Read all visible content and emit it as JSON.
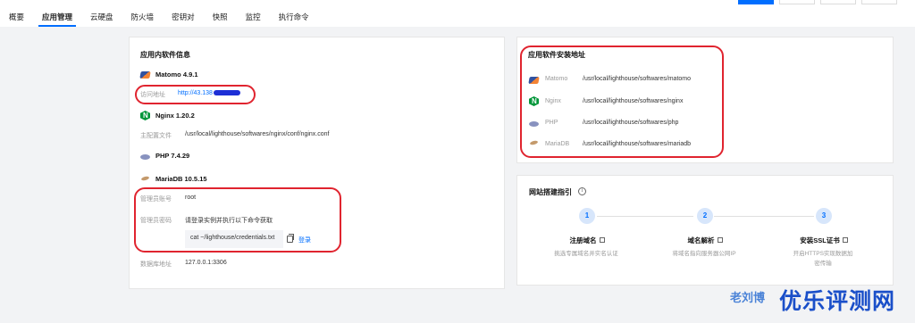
{
  "nav": {
    "tabs": [
      "概要",
      "应用管理",
      "云硬盘",
      "防火墙",
      "密钥对",
      "快照",
      "监控",
      "执行命令"
    ],
    "active_tab": "应用管理"
  },
  "left_card": {
    "title": "应用内软件信息",
    "matomo": {
      "name": "Matomo 4.9.1",
      "access_label": "访问地址",
      "access_value": "http://43.138"
    },
    "nginx": {
      "name": "Nginx 1.20.2",
      "config_label": "主配置文件",
      "config_value": "/usr/local/lighthouse/softwares/nginx/conf/nginx.conf"
    },
    "php": {
      "name": "PHP 7.4.29"
    },
    "mariadb": {
      "name": "MariaDB 10.5.15",
      "admin_user_label": "管理员账号",
      "admin_user_value": "root",
      "admin_pass_label": "管理员密码",
      "admin_pass_value": "请登录实例并执行以下命令获取",
      "command": "cat ~/lighthouse/credentials.txt",
      "login_label": "登录",
      "db_addr_label": "数据库地址",
      "db_addr_value": "127.0.0.1:3306"
    }
  },
  "install_card": {
    "title": "应用软件安装地址",
    "items": [
      {
        "name": "Matomo",
        "path": "/usr/local/lighthouse/softwares/matomo"
      },
      {
        "name": "Nginx",
        "path": "/usr/local/lighthouse/softwares/nginx"
      },
      {
        "name": "PHP",
        "path": "/usr/local/lighthouse/softwares/php"
      },
      {
        "name": "MariaDB",
        "path": "/usr/local/lighthouse/softwares/mariadb"
      }
    ]
  },
  "guide_card": {
    "title": "网站搭建指引",
    "info_symbol": "i",
    "steps": [
      {
        "num": "1",
        "title": "注册域名",
        "desc": "挑选专属域名并实名认证"
      },
      {
        "num": "2",
        "title": "域名解析",
        "desc": "将域名指向服务器公网IP"
      },
      {
        "num": "3",
        "title": "安装SSL证书",
        "desc": "开启HTTPS实现数据加密传输"
      }
    ]
  },
  "watermark": {
    "small": "老刘博",
    "large": "优乐评测网"
  },
  "colors": {
    "accent": "#006eff",
    "highlight_box": "#e0242f",
    "step_circle_bg": "#d7e6fb"
  }
}
